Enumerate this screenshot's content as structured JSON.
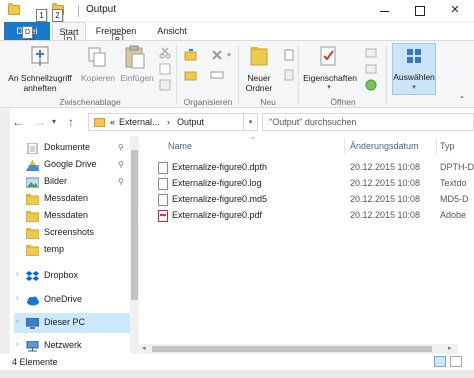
{
  "window": {
    "title": "Output",
    "keytip_1": "1",
    "keytip_2": "2",
    "minimize_glyph": "",
    "maximize_glyph": "",
    "close_glyph": "✕"
  },
  "ribbon_tabs": {
    "datei_label": "Datei",
    "datei_keytip": "D",
    "start_label": "Start",
    "start_keytip": "R",
    "freigeben_label": "Freigeben",
    "freigeben_keytip": "B",
    "ansicht_label": "Ansicht"
  },
  "ribbon": {
    "pin_label_1": "An Schnellzugriff",
    "pin_label_2": "anheften",
    "copy_label": "Kopieren",
    "paste_label": "Einfügen",
    "clipboard_group": "Zwischenablage",
    "organize_group": "Organisieren",
    "new_folder_label_1": "Neuer",
    "new_folder_label_2": "Ordner",
    "new_group": "Neu",
    "properties_label": "Eigenschaften",
    "open_group": "Öffnen",
    "select_label": "Auswählen"
  },
  "address_bar": {
    "crumb_prefix": "«",
    "crumb_1": "External...",
    "crumb_sep": "›",
    "crumb_2": "Output",
    "search_placeholder": "\"Output\" durchsuchen"
  },
  "nav_pane": {
    "items": [
      {
        "label": "Dokumente",
        "pinned": true,
        "icon": "document-icon"
      },
      {
        "label": "Google Drive",
        "pinned": true,
        "icon": "google-drive-icon"
      },
      {
        "label": "Bilder",
        "pinned": true,
        "icon": "pictures-icon"
      },
      {
        "label": "Messdaten",
        "pinned": false,
        "icon": "folder-icon"
      },
      {
        "label": "Messdaten",
        "pinned": false,
        "icon": "folder-icon"
      },
      {
        "label": "Screenshots",
        "pinned": false,
        "icon": "folder-icon"
      },
      {
        "label": "temp",
        "pinned": false,
        "icon": "folder-icon"
      },
      {
        "label": "Dropbox",
        "pinned": false,
        "icon": "dropbox-icon"
      },
      {
        "label": "OneDrive",
        "pinned": false,
        "icon": "onedrive-icon"
      },
      {
        "label": "Dieser PC",
        "pinned": false,
        "icon": "pc-icon"
      },
      {
        "label": "Netzwerk",
        "pinned": false,
        "icon": "network-icon"
      }
    ],
    "pin_glyph": "📌"
  },
  "file_list": {
    "columns": {
      "name": "Name",
      "date": "Änderungsdatum",
      "type": "Typ"
    },
    "files": [
      {
        "name": "Externalize-figure0.dpth",
        "date": "20.12.2015 10:08",
        "type": "DPTH-D"
      },
      {
        "name": "Externalize-figure0.log",
        "date": "20.12.2015 10:08",
        "type": "Textdo"
      },
      {
        "name": "Externalize-figure0.md5",
        "date": "20.12.2015 10:08",
        "type": "MD5-D"
      },
      {
        "name": "Externalize-figure0.pdf",
        "date": "20.12.2015 10:08",
        "type": "Adobe"
      }
    ]
  },
  "status": {
    "item_count": "4 Elemente"
  },
  "colors": {
    "accent": "#1979ca",
    "selection": "#cce8ff",
    "folder": "#f0c84a"
  }
}
